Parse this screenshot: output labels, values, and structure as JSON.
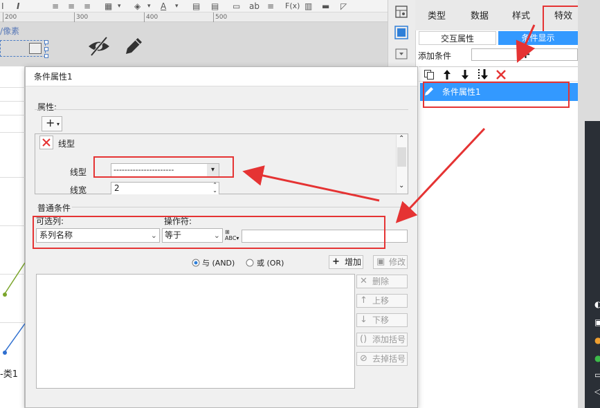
{
  "toolbar": {
    "items": [
      "I",
      "≡",
      "≡",
      "≡",
      "▦",
      "▾",
      "◈",
      "▾",
      "A",
      "▾",
      "▤",
      "▤",
      "▭",
      "ab",
      "≡",
      "F(x)",
      "▥",
      "▬",
      "◸"
    ]
  },
  "ruler": {
    "ticks": [
      "200",
      "300",
      "400",
      "500"
    ]
  },
  "canvas": {
    "element_label": "/像素"
  },
  "right_panel": {
    "tabs": [
      "类型",
      "数据",
      "样式",
      "特效"
    ],
    "active_tab": "特效",
    "subtabs": [
      "交互属性",
      "条件显示"
    ],
    "active_subtab": "条件显示",
    "add_condition_label": "添加条件",
    "add_condition_icon": "+",
    "toolbar_icons": [
      "copy-icon",
      "arrow-up-icon",
      "arrow-down-icon",
      "move-bottom-icon",
      "delete-icon"
    ],
    "conditions": [
      {
        "label": "条件属性1",
        "selected": true
      }
    ]
  },
  "dialog": {
    "title": "条件属性1",
    "attr_section": "属性:",
    "add_button_label": "+",
    "attribute_name": "线型",
    "line_type_label": "线型",
    "line_type_value": "----------------------",
    "line_width_label": "线宽",
    "line_width_value": "2",
    "normal_condition_section": "普通条件",
    "column_label": "可选列:",
    "operator_label": "操作符:",
    "column_value": "系列名称",
    "operator_value": "等于",
    "value_field": "",
    "logic_and": "与 (AND)",
    "logic_or": "或 (OR)",
    "logic_selected": "and",
    "buttons": {
      "add": "增加",
      "modify": "修改",
      "delete": "删除",
      "move_up": "上移",
      "move_down": "下移",
      "add_bracket": "添加括号",
      "remove_bracket": "去掉括号"
    }
  },
  "left_strip": {
    "label": "-类1"
  },
  "colors": {
    "accent": "#3399ff",
    "annotation_red": "#e53333",
    "dark": "#2a2f36"
  }
}
